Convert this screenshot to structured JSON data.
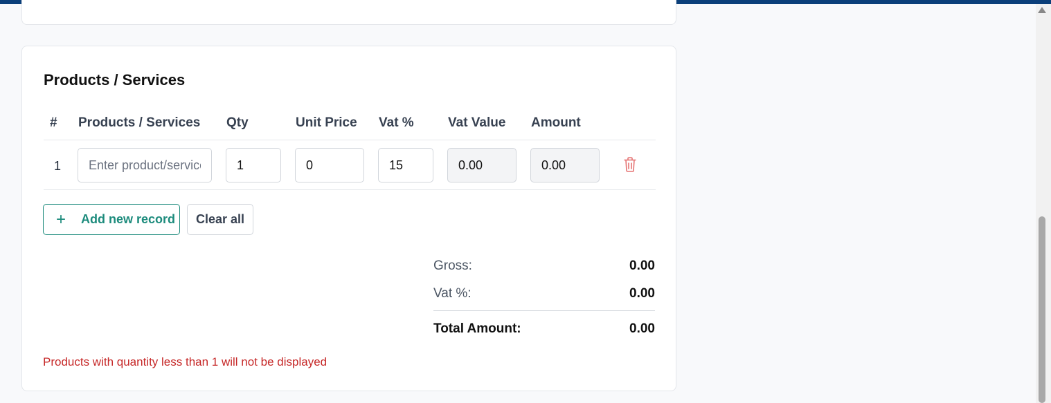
{
  "section": {
    "title": "Products / Services"
  },
  "table": {
    "headers": {
      "index": "#",
      "product": "Products / Services",
      "qty": "Qty",
      "unit_price": "Unit Price",
      "vat_pct": "Vat %",
      "vat_value": "Vat Value",
      "amount": "Amount"
    },
    "rows": [
      {
        "index": "1",
        "product_value": "",
        "product_placeholder": "Enter product/service",
        "qty": "1",
        "unit_price": "0",
        "vat_pct": "15",
        "vat_value": "0.00",
        "amount": "0.00",
        "delete_icon": "trash-icon"
      }
    ]
  },
  "actions": {
    "add_label": "Add new record",
    "add_icon": "plus-icon",
    "clear_label": "Clear all"
  },
  "summary": {
    "gross_label": "Gross:",
    "gross_value": "0.00",
    "vat_label": "Vat %:",
    "vat_value": "0.00",
    "total_label": "Total Amount:",
    "total_value": "0.00"
  },
  "warning": "Products with quantity less than 1 will not be displayed",
  "colors": {
    "accent": "#1c8b7c",
    "warning": "#c62828",
    "topbar": "#0b3f7a",
    "delete": "#e57373"
  }
}
